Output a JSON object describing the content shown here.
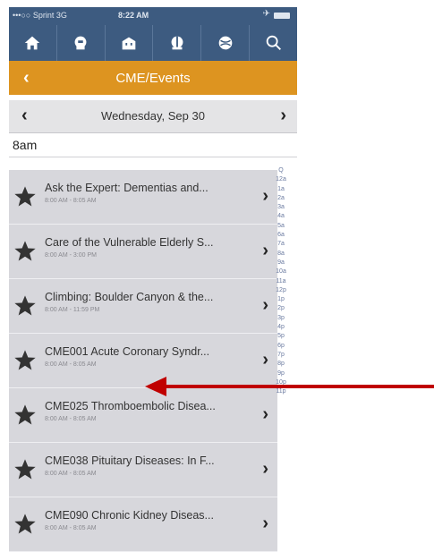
{
  "status": {
    "carrier": "•••○○ Sprint 3G",
    "time": "8:22 AM",
    "airplane": "✈"
  },
  "toolbar": {
    "icons": [
      "home-icon",
      "building-icon",
      "hospital-icon",
      "globe-building-icon",
      "globe-icon",
      "search-icon"
    ]
  },
  "header": {
    "back": "‹",
    "title": "CME/Events"
  },
  "datebar": {
    "prev": "‹",
    "date": "Wednesday, Sep 30",
    "next": "›"
  },
  "hour_header": "8am",
  "events": [
    {
      "title": "Ask the Expert: Dementias and...",
      "time": "8:00 AM - 8:05 AM"
    },
    {
      "title": "Care of the Vulnerable Elderly S...",
      "time": "8:00 AM - 3:00 PM"
    },
    {
      "title": "Climbing: Boulder Canyon & the...",
      "time": "8:00 AM - 11:59 PM"
    },
    {
      "title": "CME001 Acute Coronary Syndr...",
      "time": "8:00 AM - 8:05 AM"
    },
    {
      "title": "CME025 Thromboembolic Disea...",
      "time": "8:00 AM - 8:05 AM"
    },
    {
      "title": "CME038 Pituitary Diseases: In F...",
      "time": "8:00 AM - 8:05 AM"
    },
    {
      "title": "CME090 Chronic Kidney Diseas...",
      "time": "8:00 AM - 8:05 AM"
    }
  ],
  "chevron": "›",
  "hour_index": [
    "Q",
    "12a",
    "1a",
    "2a",
    "3a",
    "4a",
    "5a",
    "6a",
    "7a",
    "8a",
    "9a",
    "10a",
    "11a",
    "12p",
    "1p",
    "2p",
    "3p",
    "4p",
    "5p",
    "6p",
    "7p",
    "8p",
    "9p",
    "10p",
    "11p"
  ],
  "annotation": {
    "arrow_color": "#c00000"
  }
}
